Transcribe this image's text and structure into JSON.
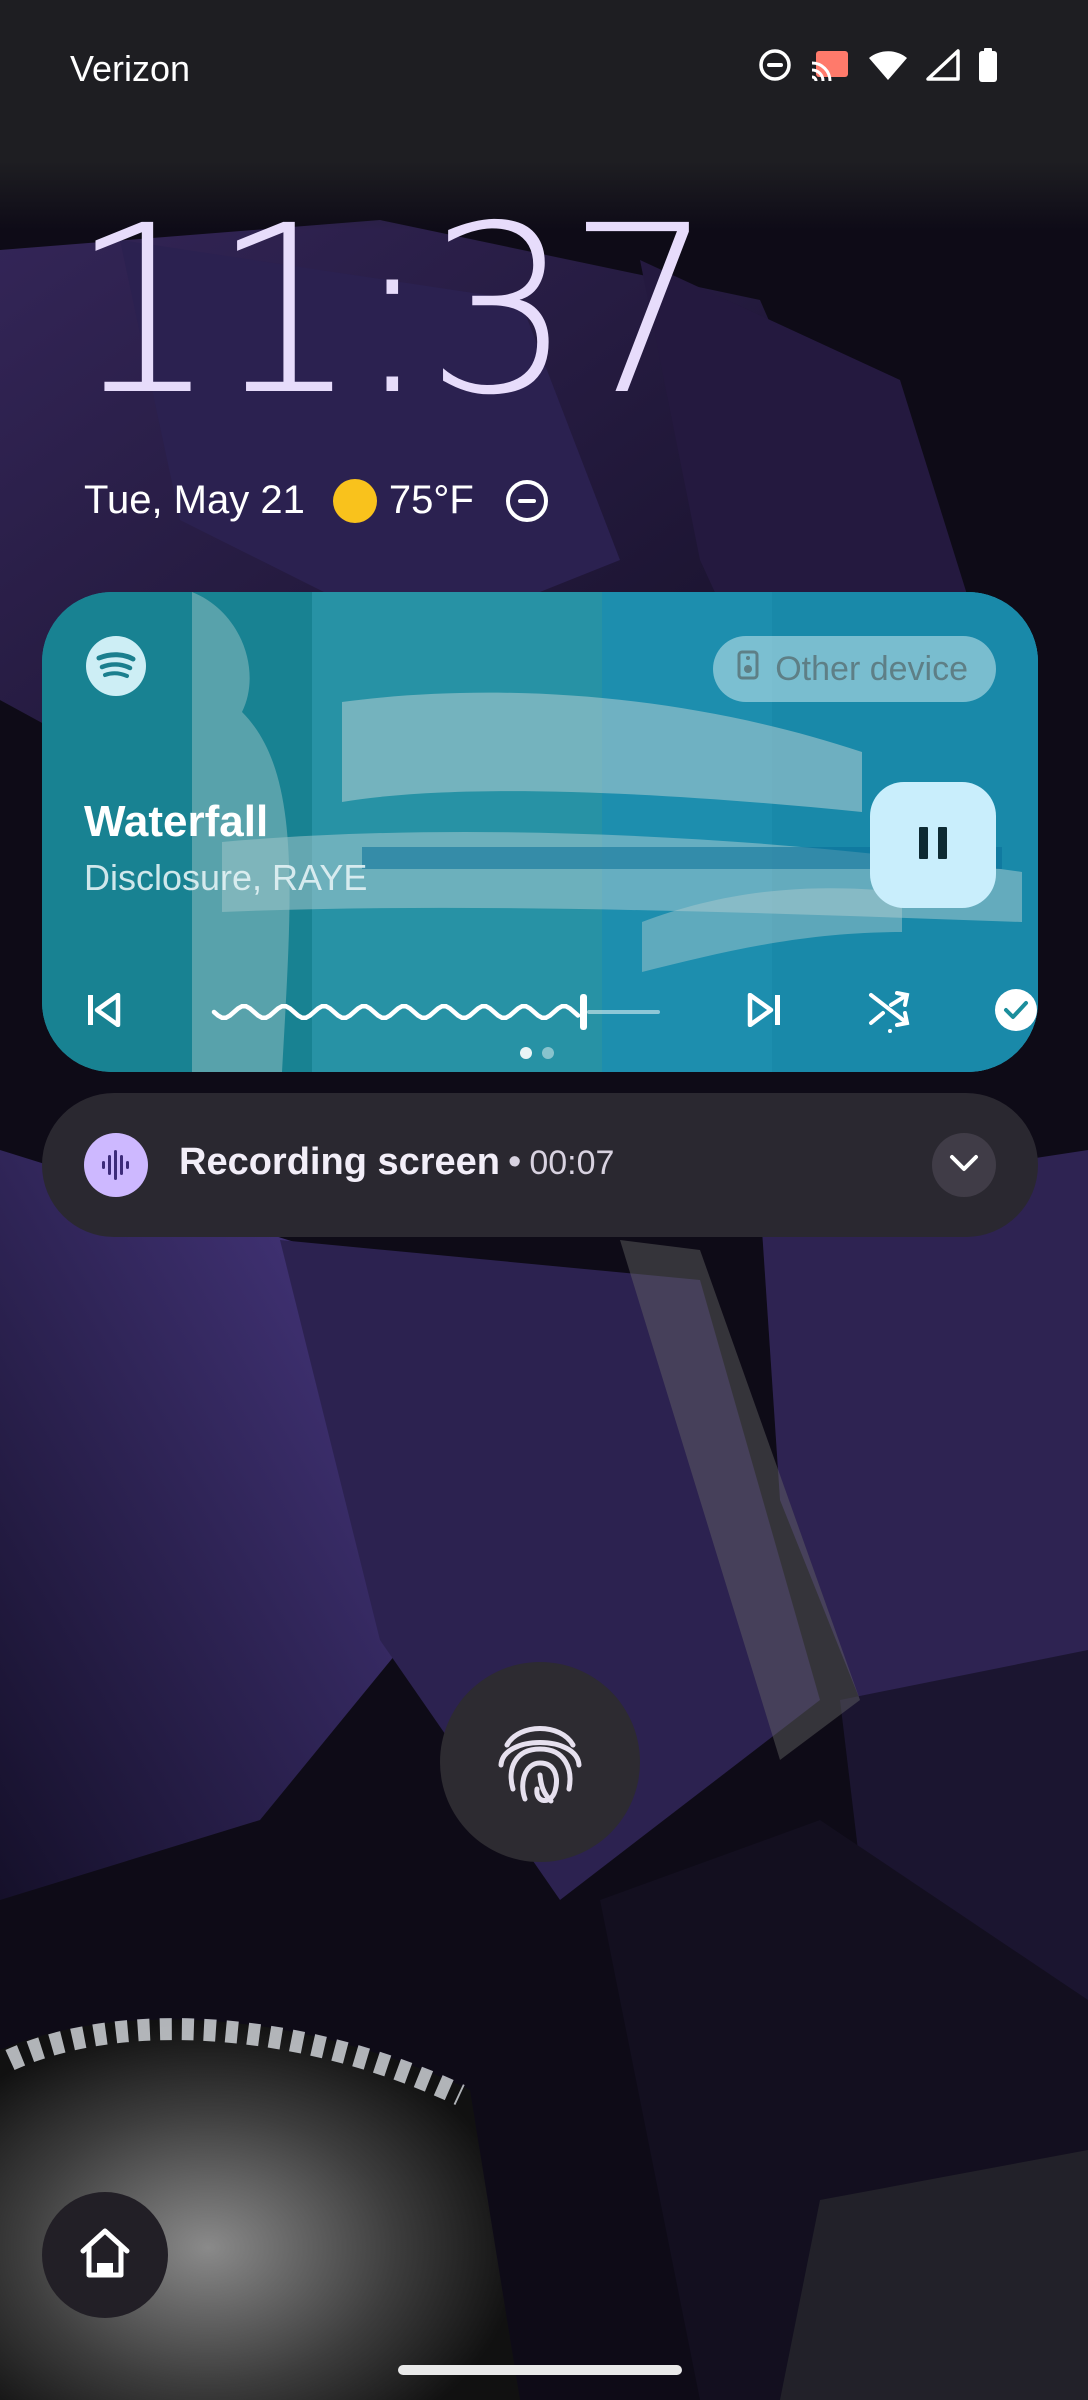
{
  "status_bar": {
    "carrier": "Verizon",
    "icons": [
      "dnd-icon",
      "cast-icon",
      "wifi-icon",
      "signal-icon",
      "battery-icon"
    ]
  },
  "lockscreen": {
    "time": "11:37",
    "date": "Tue, May 21",
    "weather_icon": "sun-icon",
    "temperature": "75°F",
    "dnd_indicator": "dnd-icon"
  },
  "media": {
    "app_icon": "spotify-icon",
    "output_device_label": "Other device",
    "title": "Waterfall",
    "artist": "Disclosure, RAYE",
    "progress": 0.91,
    "controls": [
      "previous-icon",
      "seek-bar",
      "next-icon",
      "shuffle-icon",
      "saved-check-icon"
    ],
    "pages": 2,
    "active_page": 1,
    "colors": {
      "card": "#1ba0c6",
      "pause_button": "#c9eefc"
    }
  },
  "notification": {
    "icon": "recording-waveform-icon",
    "title": "Recording screen",
    "separator": "•",
    "elapsed": "00:07"
  },
  "fingerprint_icon": "fingerprint-icon",
  "home_shortcut_icon": "home-icon"
}
